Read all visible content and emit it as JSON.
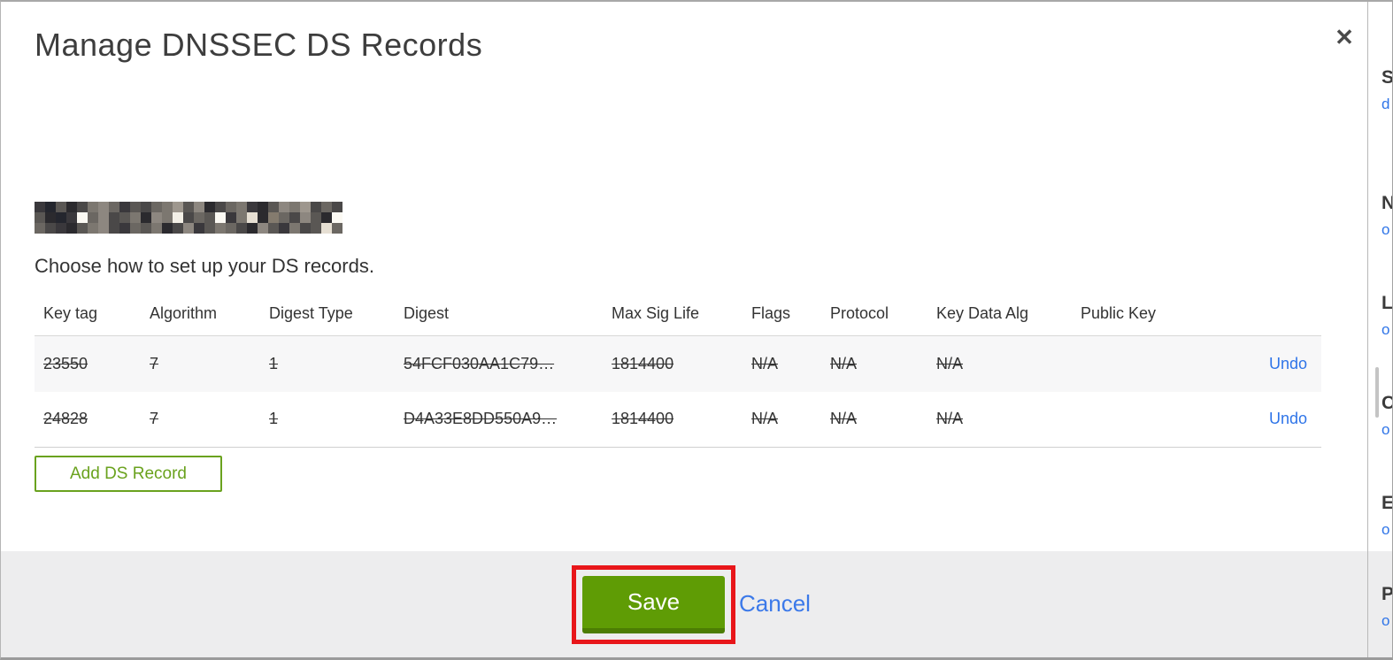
{
  "modal": {
    "title": "Manage DNSSEC DS Records",
    "close_icon": "✕",
    "instruction": "Choose how to set up your DS records.",
    "add_button_label": "Add DS Record",
    "save_label": "Save",
    "cancel_label": "Cancel"
  },
  "table": {
    "headers": {
      "key_tag": "Key tag",
      "algorithm": "Algorithm",
      "digest_type": "Digest Type",
      "digest": "Digest",
      "max_sig_life": "Max Sig Life",
      "flags": "Flags",
      "protocol": "Protocol",
      "key_data_alg": "Key Data Alg",
      "public_key": "Public Key"
    },
    "rows": [
      {
        "key_tag": "23550",
        "algorithm": "7",
        "digest_type": "1",
        "digest": "54FCF030AA1C79…",
        "max_sig_life": "1814400",
        "flags": "N/A",
        "protocol": "N/A",
        "key_data_alg": "N/A",
        "public_key": "",
        "action": "Undo",
        "state": "pending-delete"
      },
      {
        "key_tag": "24828",
        "algorithm": "7",
        "digest_type": "1",
        "digest": "D4A33E8DD550A9…",
        "max_sig_life": "1814400",
        "flags": "N/A",
        "protocol": "N/A",
        "key_data_alg": "N/A",
        "public_key": "",
        "action": "Undo",
        "state": "pending-delete"
      }
    ]
  },
  "colors": {
    "green_button": "#5f9c05",
    "green_button_dark": "#4c7d04",
    "green_outline": "#6aa21e",
    "link_blue": "#2e74e8",
    "annotation_red": "#e8161a",
    "footer_gray": "#ededee",
    "row_gray": "#f7f7f8",
    "text_dark": "#333333",
    "border_gray": "#d8d8d8"
  },
  "redacted_domain": {
    "cols": 29,
    "rows": 3,
    "block": 12,
    "palette": [
      "#2b2a2e",
      "#3a383c",
      "#4a4848",
      "#5a5754",
      "#6b6762",
      "#7c7770",
      "#8d8780",
      "#9e978e",
      "#b0a89d",
      "#c2baae",
      "#d5cdc0",
      "#e6dfd3",
      "#f3efe6",
      "#24262e",
      "#847b6e",
      "#fbf9f3"
    ],
    "cells": [
      "1d302564132457360245103657242",
      "30d1f46235065c243f15b0e42630f",
      "421035621435026135420631523b4"
    ]
  },
  "background_page": {
    "fragments": [
      {
        "letter": "S",
        "link": "d"
      },
      {
        "letter": "N",
        "link": "o"
      },
      {
        "letter": "L",
        "link": "o"
      },
      {
        "letter": "C",
        "link": "o"
      },
      {
        "letter": "E",
        "link": "o"
      },
      {
        "letter": "P",
        "link": "o"
      }
    ]
  }
}
